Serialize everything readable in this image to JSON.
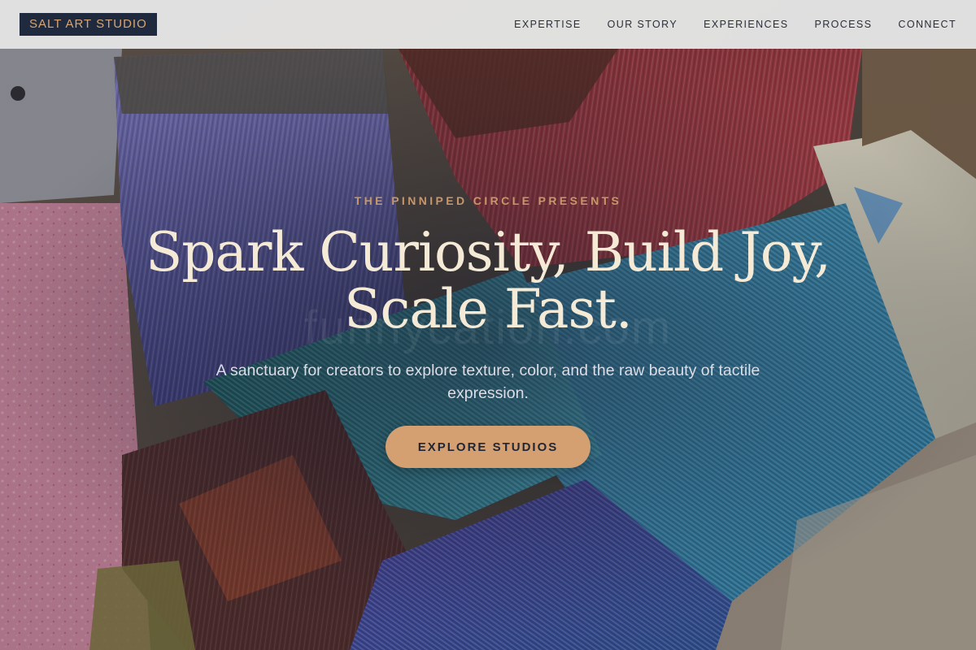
{
  "brand": {
    "logo_text": "SALT ART STUDIO"
  },
  "nav": {
    "items": [
      {
        "label": "EXPERTISE"
      },
      {
        "label": "OUR STORY"
      },
      {
        "label": "EXPERIENCES"
      },
      {
        "label": "PROCESS"
      },
      {
        "label": "CONNECT"
      }
    ]
  },
  "hero": {
    "eyebrow": "THE PINNIPED CIRCLE PRESENTS",
    "headline_line1": "Spark Curiosity, Build Joy,",
    "headline_line2": "Scale Fast.",
    "subtitle": "A sanctuary for creators to explore texture, color, and the raw beauty of tactile expression.",
    "cta_label": "EXPLORE STUDIOS",
    "watermark": "funnycation.com",
    "background_image": "painted-brushes-photo"
  },
  "colors": {
    "accent": "#d4a072",
    "eyebrow": "#c89668",
    "headline": "#f4ead6",
    "logo_bg": "#1f2a3f",
    "logo_text": "#d7a574",
    "nav_bg": "#ececec"
  }
}
